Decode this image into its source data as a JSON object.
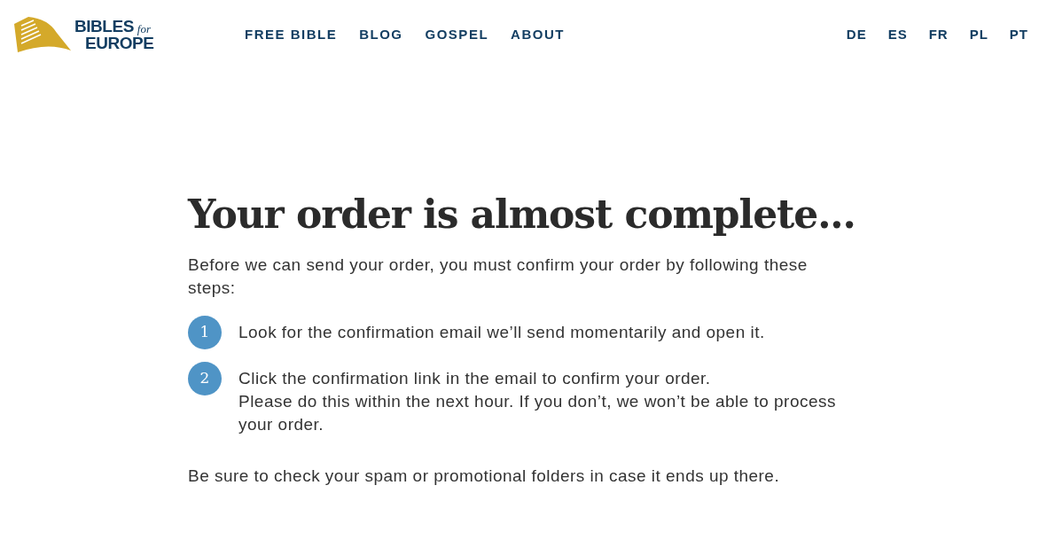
{
  "header": {
    "logo": {
      "line_1": "BIBLES",
      "small": "for",
      "line_2": "EUROPE"
    },
    "nav": [
      "FREE BIBLE",
      "BLOG",
      "GOSPEL",
      "ABOUT"
    ],
    "languages": [
      "DE",
      "ES",
      "FR",
      "PL",
      "PT"
    ]
  },
  "main": {
    "title": "Your order is almost complete...",
    "intro": "Before we can send your order, you must confirm your order by following these steps:",
    "steps": [
      {
        "number": "1",
        "lines": [
          "Look for the confirmation email we’ll send momentarily and open it."
        ]
      },
      {
        "number": "2",
        "lines": [
          "Click the confirmation link in the email to confirm your order.",
          "Please do this within the next hour. If you don’t, we won’t be able to process your order."
        ]
      }
    ],
    "note": "Be sure to check your spam or promotional folders in case it ends up there."
  }
}
